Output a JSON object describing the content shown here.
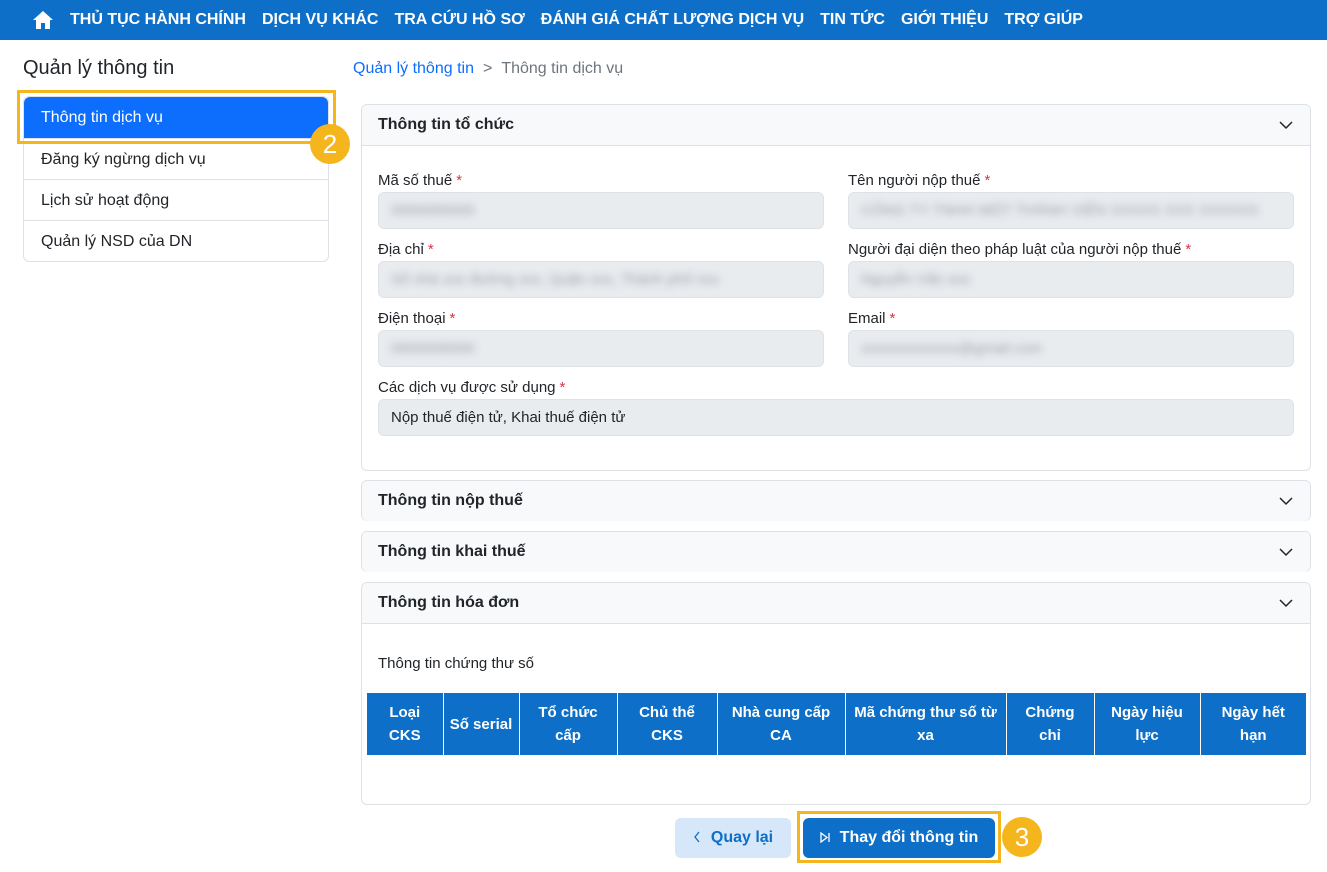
{
  "topnav": {
    "home_icon": "home-icon",
    "items": [
      "THỦ TỤC HÀNH CHÍNH",
      "DỊCH VỤ KHÁC",
      "TRA CỨU HỒ SƠ",
      "ĐÁNH GIÁ CHẤT LƯỢNG DỊCH VỤ",
      "TIN TỨC",
      "GIỚI THIỆU",
      "TRỢ GIÚP"
    ]
  },
  "sidebar": {
    "title": "Quản lý thông tin",
    "items": [
      {
        "label": "Thông tin dịch vụ",
        "active": true
      },
      {
        "label": "Đăng ký ngừng dịch vụ"
      },
      {
        "label": "Lịch sử hoạt động"
      },
      {
        "label": "Quản lý NSD của DN"
      }
    ]
  },
  "breadcrumb": {
    "parent": "Quản lý thông tin",
    "separator": ">",
    "current": "Thông tin dịch vụ"
  },
  "org_panel": {
    "title": "Thông tin tổ chức",
    "required_mark": "*",
    "fields": {
      "tax_code": {
        "label": "Mã số thuế",
        "value": "0000000000"
      },
      "taxpayer_name": {
        "label": "Tên người nộp thuế",
        "value": "CÔNG TY TNHH MỘT THÀNH VIÊN XXXXX XXX XXXXXX"
      },
      "address": {
        "label": "Địa chỉ",
        "value": "Số nhà xxx đường xxx, Quận xxx, Thành phố xxx"
      },
      "legal_rep": {
        "label": "Người đại diện theo pháp luật của người nộp thuế",
        "value": "Nguyễn Văn xxx"
      },
      "phone": {
        "label": "Điện thoại",
        "value": "0000000000"
      },
      "email": {
        "label": "Email",
        "value": "xxxxxxxxxxxxx@gmail.com"
      },
      "services": {
        "label": "Các dịch vụ được sử dụng",
        "value": "Nộp thuế điện tử, Khai thuế điện tử"
      }
    }
  },
  "panels": {
    "tax_payment": "Thông tin nộp thuế",
    "tax_declaration": "Thông tin khai thuế",
    "invoice": "Thông tin hóa đơn"
  },
  "invoice_panel": {
    "subtitle": "Thông tin chứng thư số",
    "table_headers": [
      "Loại CKS",
      "Số serial",
      "Tổ chức cấp",
      "Chủ thể CKS",
      "Nhà cung cấp CA",
      "Mã chứng thư số từ xa",
      "Chứng chỉ",
      "Ngày hiệu lực",
      "Ngày hết hạn"
    ],
    "rows": []
  },
  "buttons": {
    "back": "Quay lại",
    "back_icon": "chevron-left-icon",
    "change": "Thay đổi thông tin",
    "change_icon": "play-icon"
  },
  "steps": {
    "sidebar_step": "2",
    "button_step": "3"
  },
  "colors": {
    "nav_bg": "#0d6fc7",
    "active_item": "#0d6efd",
    "highlight": "#f5b51c",
    "required": "#dc3545"
  }
}
